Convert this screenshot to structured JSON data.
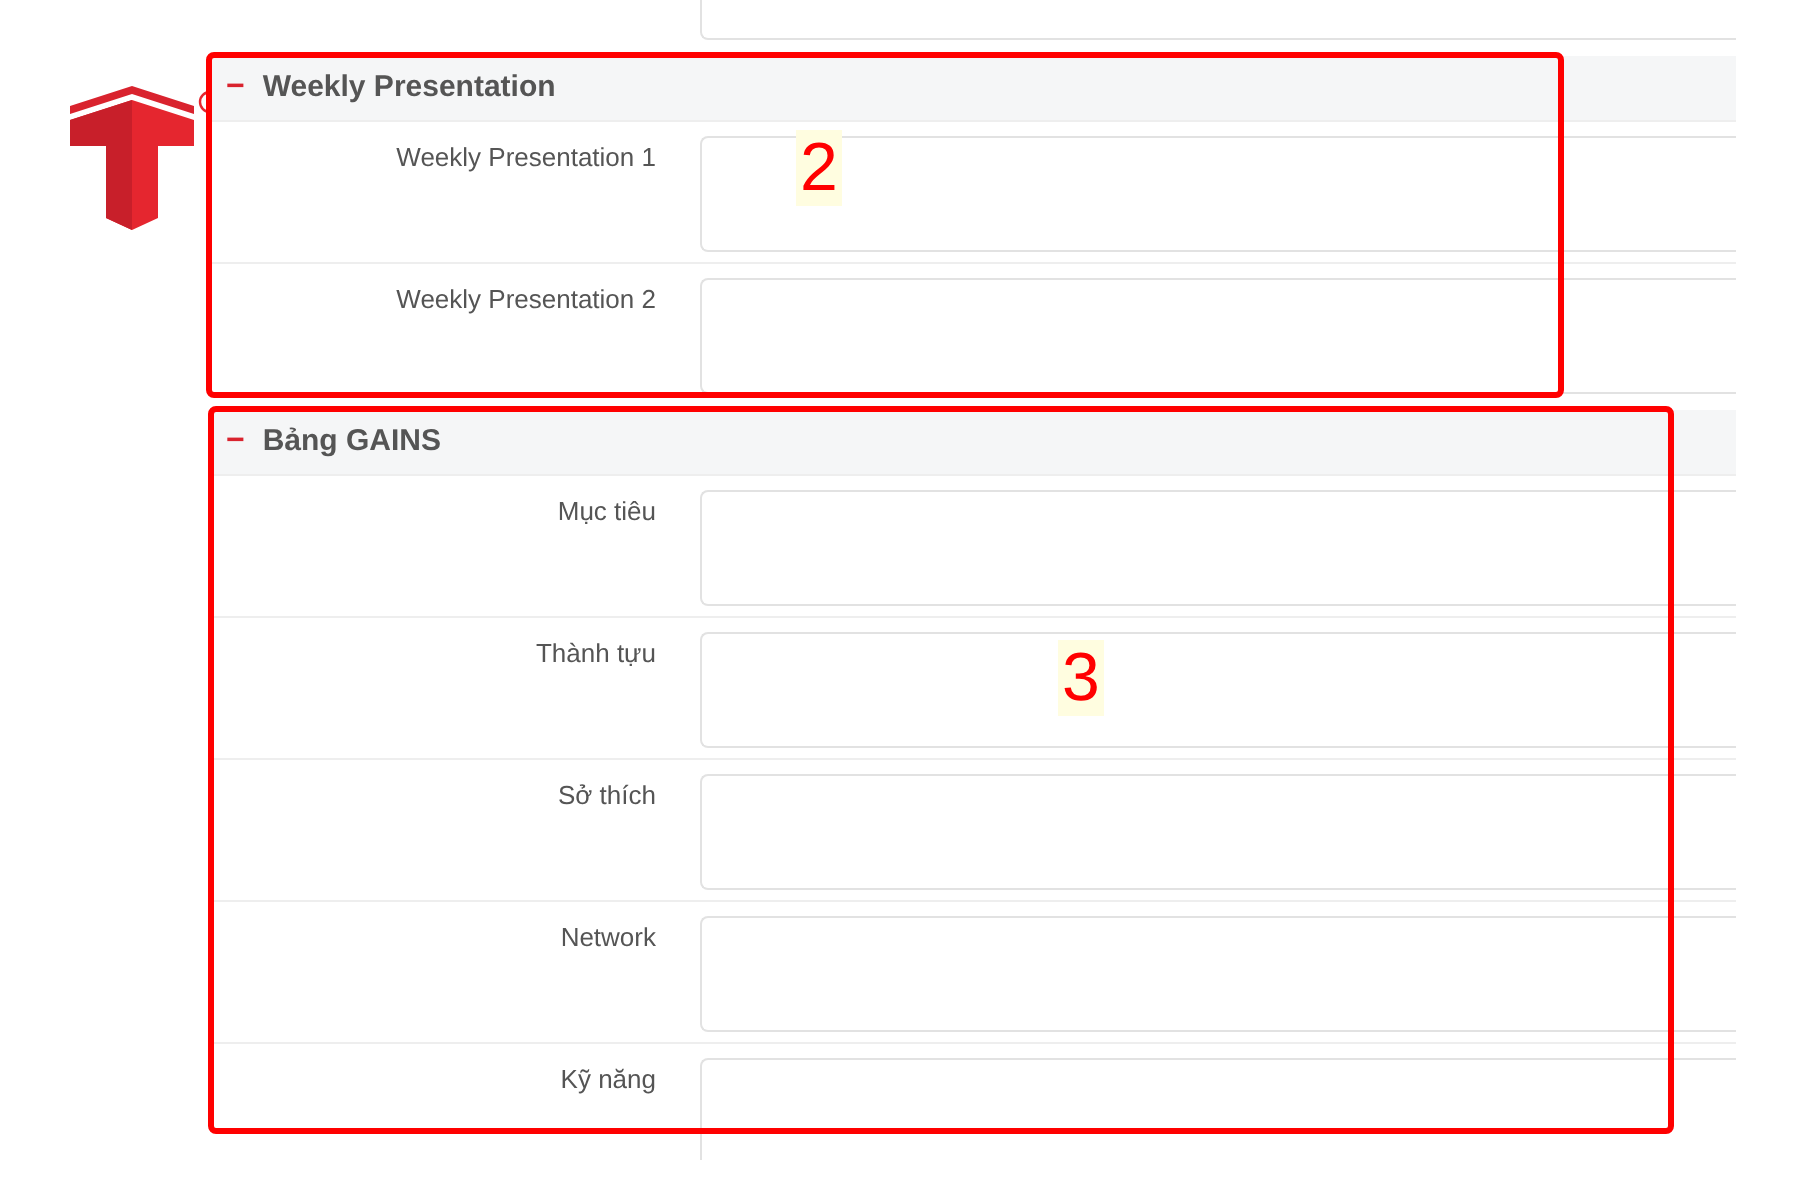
{
  "sections": [
    {
      "title": "Weekly Presentation",
      "toggle_symbol": "−",
      "fields": [
        {
          "label": "Weekly Presentation 1"
        },
        {
          "label": "Weekly Presentation 2"
        }
      ]
    },
    {
      "title": "Bảng GAINS",
      "toggle_symbol": "−",
      "fields": [
        {
          "label": "Mục tiêu"
        },
        {
          "label": "Thành tựu"
        },
        {
          "label": "Sở thích"
        },
        {
          "label": "Network"
        },
        {
          "label": "Kỹ năng"
        }
      ]
    }
  ],
  "annotations": [
    {
      "label": "2"
    },
    {
      "label": "3"
    }
  ]
}
